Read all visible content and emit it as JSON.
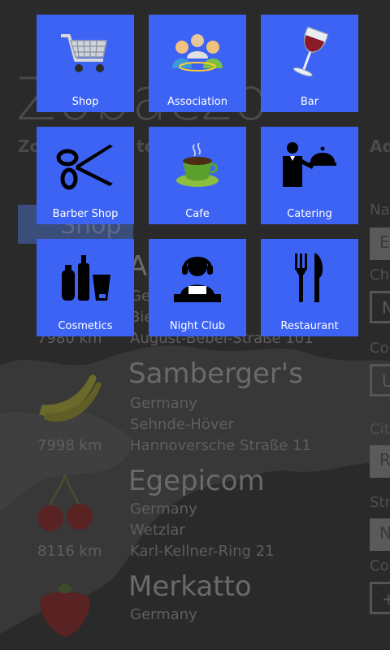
{
  "background": {
    "title": "Zobaczo",
    "tab_left": "Zo",
    "tab_mid": "to",
    "tab_right": "Ad",
    "shop_filter": "Shop",
    "right_labels": [
      "Na",
      "Ch",
      "Co",
      "Cit",
      "Str",
      "Co"
    ],
    "right_box_values": [
      "E",
      "N",
      "U",
      "R",
      "N",
      "+"
    ],
    "listings": [
      {
        "name": "A",
        "country": "Ge",
        "city": "Bie",
        "street": "August-Bebel-Straße 101",
        "distance": "7980 km",
        "thumb": "banana"
      },
      {
        "name": "Samberger's",
        "country": "Germany",
        "city": "Sehnde-Höver",
        "street": "Hannoversche Straße 11",
        "distance": "7998 km",
        "thumb": "banana"
      },
      {
        "name": "Egepicom",
        "country": "Germany",
        "city": "Wetzlar",
        "street": "Karl-Kellner-Ring 21",
        "distance": "8116 km",
        "thumb": "cherry"
      },
      {
        "name": "Merkatto",
        "country": "Germany",
        "city": "",
        "street": "",
        "distance": "",
        "thumb": "strawberry"
      }
    ]
  },
  "tiles": [
    {
      "label": "Shop",
      "icon": "shopping-cart-icon"
    },
    {
      "label": "Association",
      "icon": "people-group-icon"
    },
    {
      "label": "Bar",
      "icon": "wine-glass-icon"
    },
    {
      "label": "Barber Shop",
      "icon": "scissors-icon"
    },
    {
      "label": "Cafe",
      "icon": "coffee-cup-icon"
    },
    {
      "label": "Catering",
      "icon": "waiter-icon"
    },
    {
      "label": "Cosmetics",
      "icon": "cosmetics-bottles-icon"
    },
    {
      "label": "Night Club",
      "icon": "dj-icon"
    },
    {
      "label": "Restaurant",
      "icon": "fork-knife-icon"
    }
  ],
  "colors": {
    "tile": "#3d63f5",
    "background": "#2a2a2a"
  }
}
